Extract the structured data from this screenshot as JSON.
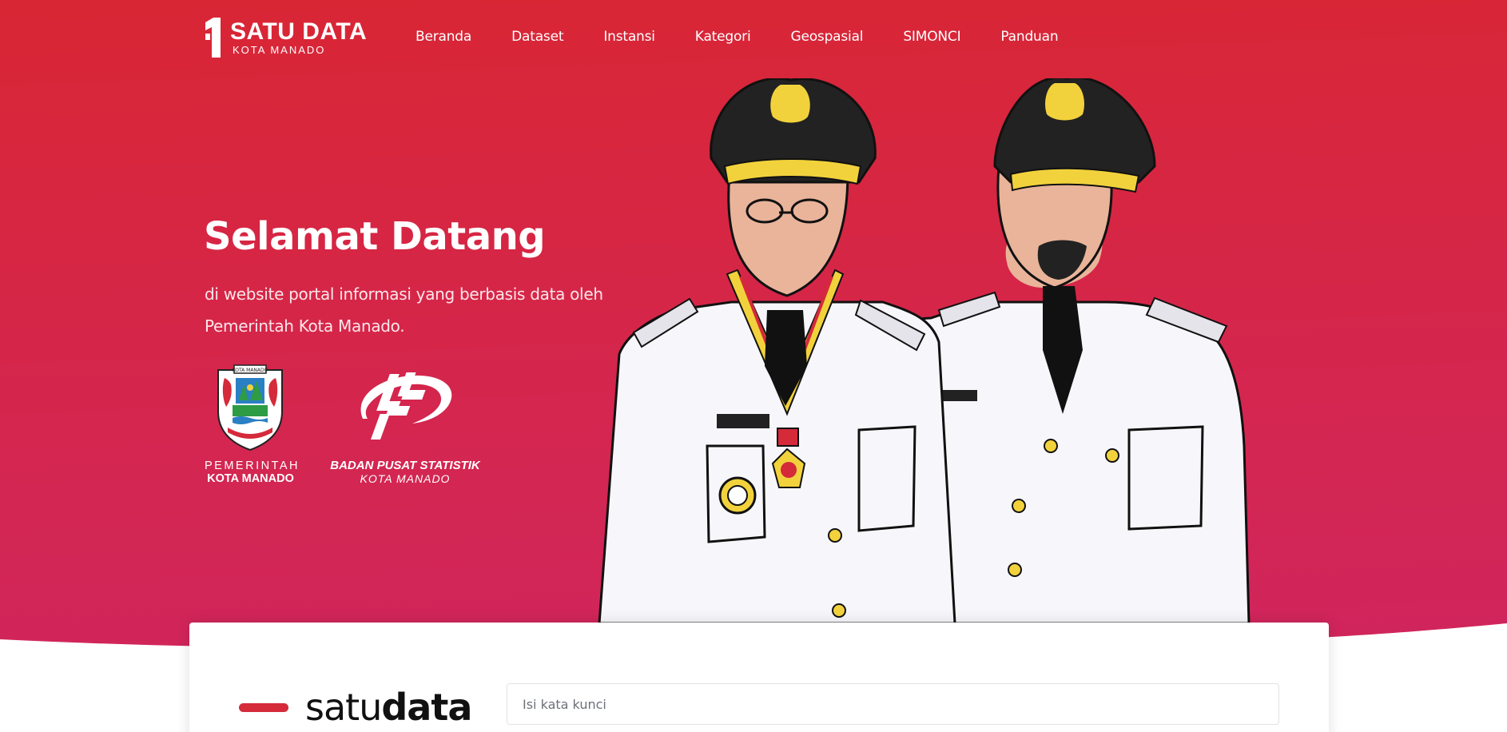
{
  "brand": {
    "title": "SATU DATA",
    "subtitle": "KOTA MANADO"
  },
  "nav": {
    "items": [
      {
        "label": "Beranda"
      },
      {
        "label": "Dataset"
      },
      {
        "label": "Instansi"
      },
      {
        "label": "Kategori"
      },
      {
        "label": "Geospasial"
      },
      {
        "label": "SIMONCI"
      },
      {
        "label": "Panduan"
      }
    ]
  },
  "hero": {
    "title": "Selamat Datang",
    "description": "di website portal informasi yang berbasis data oleh Pemerintah Kota Manado."
  },
  "logos": {
    "pemkot": {
      "line1": "PEMERINTAH",
      "line2": "KOTA MANADO",
      "crest_text": "KOTA MANADO",
      "icon": "city-crest-icon"
    },
    "bps": {
      "line1": "BADAN PUSAT STATISTIK",
      "line2": "KOTA MANADO",
      "icon": "bps-logo-icon"
    }
  },
  "illustration": {
    "icon": "officials-illustration"
  },
  "search": {
    "logo_light": "satu",
    "logo_bold": "data",
    "placeholder": "Isi kata kunci"
  },
  "colors": {
    "hero_top": "#d92634",
    "hero_bottom": "#cf2562",
    "accent": "#d42a3a"
  }
}
